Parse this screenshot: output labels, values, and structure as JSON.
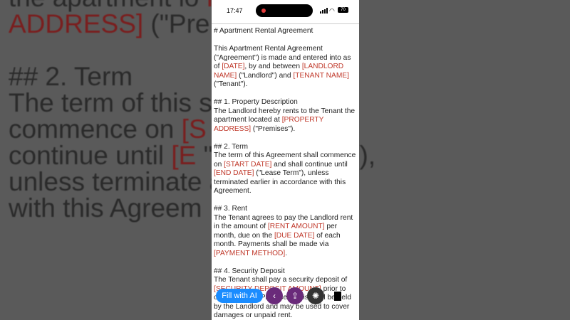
{
  "background_lines": [
    [
      {
        "t": "the apartment lo"
      },
      {
        "t": "              "
      },
      {
        "t": "ROPERTY",
        "red": true
      }
    ],
    [
      {
        "t": "ADDRESS]",
        "red": true
      },
      {
        "t": " (\"Pre"
      }
    ],
    [
      {
        "t": ""
      }
    ],
    [
      {
        "t": "## 2. Term"
      }
    ],
    [
      {
        "t": "The term of this"
      },
      {
        "t": "              shall"
      }
    ],
    [
      {
        "t": "commence on "
      },
      {
        "t": "[S",
        "red": true
      },
      {
        "t": "             "
      },
      {
        "t": "E]",
        "red": true
      },
      {
        "t": " and shall"
      }
    ],
    [
      {
        "t": "continue until "
      },
      {
        "t": "[E",
        "red": true
      },
      {
        "t": "             \"Lease Term\"),"
      }
    ],
    [
      {
        "t": "unless terminate"
      },
      {
        "t": "              accordance"
      }
    ],
    [
      {
        "t": "with this Agreem"
      }
    ]
  ],
  "status_bar": {
    "time": "17:47",
    "battery": "70"
  },
  "document": [
    [
      {
        "t": "# Apartment Rental Agreement"
      }
    ],
    [
      {
        "t": "This Apartment Rental Agreement (\"Agreement\") is made and entered into as of "
      },
      {
        "t": "[DATE]",
        "ph": true
      },
      {
        "t": ", by and between "
      },
      {
        "t": "[LANDLORD NAME]",
        "ph": true
      },
      {
        "t": " (\"Landlord\") and "
      },
      {
        "t": "[TENANT NAME]",
        "ph": true
      },
      {
        "t": " (\"Tenant\")."
      }
    ],
    [
      {
        "t": "## 1. Property Description"
      },
      {
        "br": true
      },
      {
        "t": "The Landlord hereby rents to the Tenant the apartment located at "
      },
      {
        "t": "[PROPERTY ADDRESS]",
        "ph": true
      },
      {
        "t": " (\"Premises\")."
      }
    ],
    [
      {
        "t": "## 2. Term"
      },
      {
        "br": true
      },
      {
        "t": "The term of this Agreement shall commence on "
      },
      {
        "t": "[START DATE]",
        "ph": true
      },
      {
        "t": " and shall continue until "
      },
      {
        "t": "[END DATE]",
        "ph": true
      },
      {
        "t": " (\"Lease Term\"), unless terminated earlier in accordance with this Agreement."
      }
    ],
    [
      {
        "t": "## 3. Rent"
      },
      {
        "br": true
      },
      {
        "t": "The Tenant agrees to pay the Landlord rent in the amount of "
      },
      {
        "t": "[RENT AMOUNT]",
        "ph": true
      },
      {
        "t": " per month, due on the "
      },
      {
        "t": "[DUE DATE]",
        "ph": true
      },
      {
        "t": " of each month. Payments shall be made via "
      },
      {
        "t": "[PAYMENT METHOD]",
        "ph": true
      },
      {
        "t": "."
      }
    ],
    [
      {
        "t": "## 4. Security Deposit"
      },
      {
        "br": true
      },
      {
        "t": "The Tenant shall pay a security deposit of "
      },
      {
        "t": "[SECURITY DEPOSIT AMOUNT]",
        "ph": true
      },
      {
        "t": " prior to occupying the Premises. This shall be held by the Landlord and may be used to cover damages or unpaid rent."
      }
    ]
  ],
  "toolbar": {
    "fill_label": "Fill with AI",
    "back_icon": "‹",
    "share_icon": "⇪",
    "ai_icon": "✺"
  }
}
